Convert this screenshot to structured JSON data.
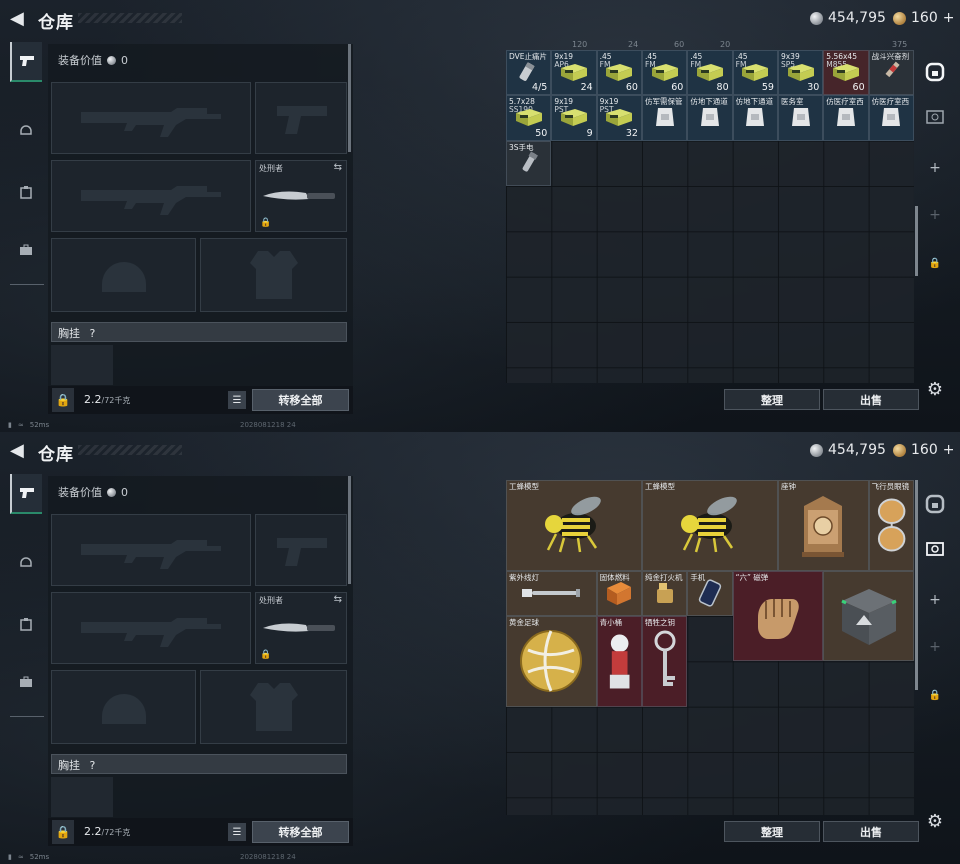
{
  "screens": [
    {
      "title": "仓库",
      "currency": {
        "silver": "454,795",
        "gold": "160",
        "gold_plus": "+"
      },
      "loadout": {
        "value_label": "装备价值",
        "value": "0",
        "knife_label": "处刑者",
        "chest_rig_label": "胸挂",
        "chest_rig_help": "?",
        "weight": "2.2",
        "weight_max": "/72千克",
        "transfer_all": "转移全部"
      },
      "inventory_header_fragments": [
        "120",
        "24",
        "60",
        "20",
        "375"
      ],
      "items": [
        {
          "name": "DVE止痛片",
          "name2": "",
          "count": "4/5",
          "bg": "blue",
          "icon": "pill-tube-icon"
        },
        {
          "name": "9x19",
          "name2": "AP6",
          "count": "24",
          "bg": "blue",
          "icon": "ammo-box-icon"
        },
        {
          "name": ".45",
          "name2": "FM",
          "count": "60",
          "bg": "blue",
          "icon": "ammo-box-icon"
        },
        {
          "name": ".45",
          "name2": "FM",
          "count": "60",
          "bg": "blue",
          "icon": "ammo-box-icon"
        },
        {
          "name": ".45",
          "name2": "FM",
          "count": "80",
          "bg": "blue",
          "icon": "ammo-box-icon"
        },
        {
          "name": ".45",
          "name2": "FM",
          "count": "59",
          "bg": "blue",
          "icon": "ammo-box-icon"
        },
        {
          "name": "9x39",
          "name2": "SP5",
          "count": "30",
          "bg": "blue",
          "icon": "ammo-box-icon"
        },
        {
          "name": "5.56x45",
          "name2": "M855",
          "count": "60",
          "bg": "red",
          "icon": "ammo-box-icon"
        },
        {
          "name": "战斗兴奋剂",
          "name2": "",
          "count": "",
          "bg": "dark",
          "icon": "syringe-icon"
        },
        {
          "name": "5.7x28",
          "name2": "SS190",
          "count": "50",
          "bg": "blue",
          "icon": "ammo-box-icon"
        },
        {
          "name": "9x19",
          "name2": "PST",
          "count": "9",
          "bg": "blue",
          "icon": "ammo-box-icon"
        },
        {
          "name": "9x19",
          "name2": "PST",
          "count": "32",
          "bg": "blue",
          "icon": "ammo-box-icon"
        },
        {
          "name": "仿军需保管",
          "name2": "",
          "count": "",
          "bg": "blue",
          "icon": "gauze-bag-icon"
        },
        {
          "name": "仿地下通道",
          "name2": "",
          "count": "",
          "bg": "blue",
          "icon": "gauze-bag-icon"
        },
        {
          "name": "仿地下通道",
          "name2": "",
          "count": "",
          "bg": "blue",
          "icon": "gauze-bag-icon"
        },
        {
          "name": "医务室",
          "name2": "",
          "count": "",
          "bg": "blue",
          "icon": "gauze-bag-icon"
        },
        {
          "name": "仿医疗室西",
          "name2": "",
          "count": "",
          "bg": "blue",
          "icon": "gauze-bag-icon"
        },
        {
          "name": "仿医疗室西",
          "name2": "",
          "count": "",
          "bg": "blue",
          "icon": "gauze-bag-icon"
        },
        {
          "name": "3S手电",
          "name2": "",
          "count": "",
          "bg": "dark",
          "icon": "flashlight-icon"
        }
      ],
      "sort_label": "整理",
      "sell_label": "出售",
      "status_ping": "52ms",
      "build_id": "2028081218 24"
    },
    {
      "title": "仓库",
      "currency": {
        "silver": "454,795",
        "gold": "160",
        "gold_plus": "+"
      },
      "loadout": {
        "value_label": "装备价值",
        "value": "0",
        "knife_label": "处刑者",
        "chest_rig_label": "胸挂",
        "chest_rig_help": "?",
        "weight": "2.2",
        "weight_max": "/72千克",
        "transfer_all": "转移全部"
      },
      "collectibles": [
        {
          "name": "工蜂模型",
          "bg": "bronze",
          "icon": "bee-model-icon"
        },
        {
          "name": "工蜂模型",
          "bg": "bronze",
          "icon": "bee-model-icon"
        },
        {
          "name": "座钟",
          "bg": "bronze",
          "icon": "mantel-clock-icon"
        },
        {
          "name": "飞行员眼镜",
          "bg": "bronze",
          "icon": "aviator-glasses-icon"
        },
        {
          "name": "紫外线灯",
          "bg": "bronze",
          "icon": "uv-lamp-icon"
        },
        {
          "name": "固体燃料",
          "bg": "bronze",
          "icon": "fuel-box-icon"
        },
        {
          "name": "纯金打火机",
          "bg": "bronze",
          "icon": "lighter-icon"
        },
        {
          "name": "手机",
          "bg": "bronze",
          "icon": "phone-icon"
        },
        {
          "name": "“六” 磁弹",
          "bg": "maroon",
          "icon": "glove-icon"
        },
        {
          "name": "",
          "bg": "bronze",
          "icon": "supply-crate-icon"
        },
        {
          "name": "黄金足球",
          "bg": "bronze",
          "icon": "gold-football-icon"
        },
        {
          "name": "青小桶",
          "bg": "maroon",
          "icon": "figurine-icon"
        },
        {
          "name": "牺牲之钥",
          "bg": "maroon",
          "icon": "ornate-key-icon"
        }
      ],
      "sort_label": "整理",
      "sell_label": "出售",
      "status_ping": "52ms",
      "build_id": "2028081218 24"
    }
  ]
}
